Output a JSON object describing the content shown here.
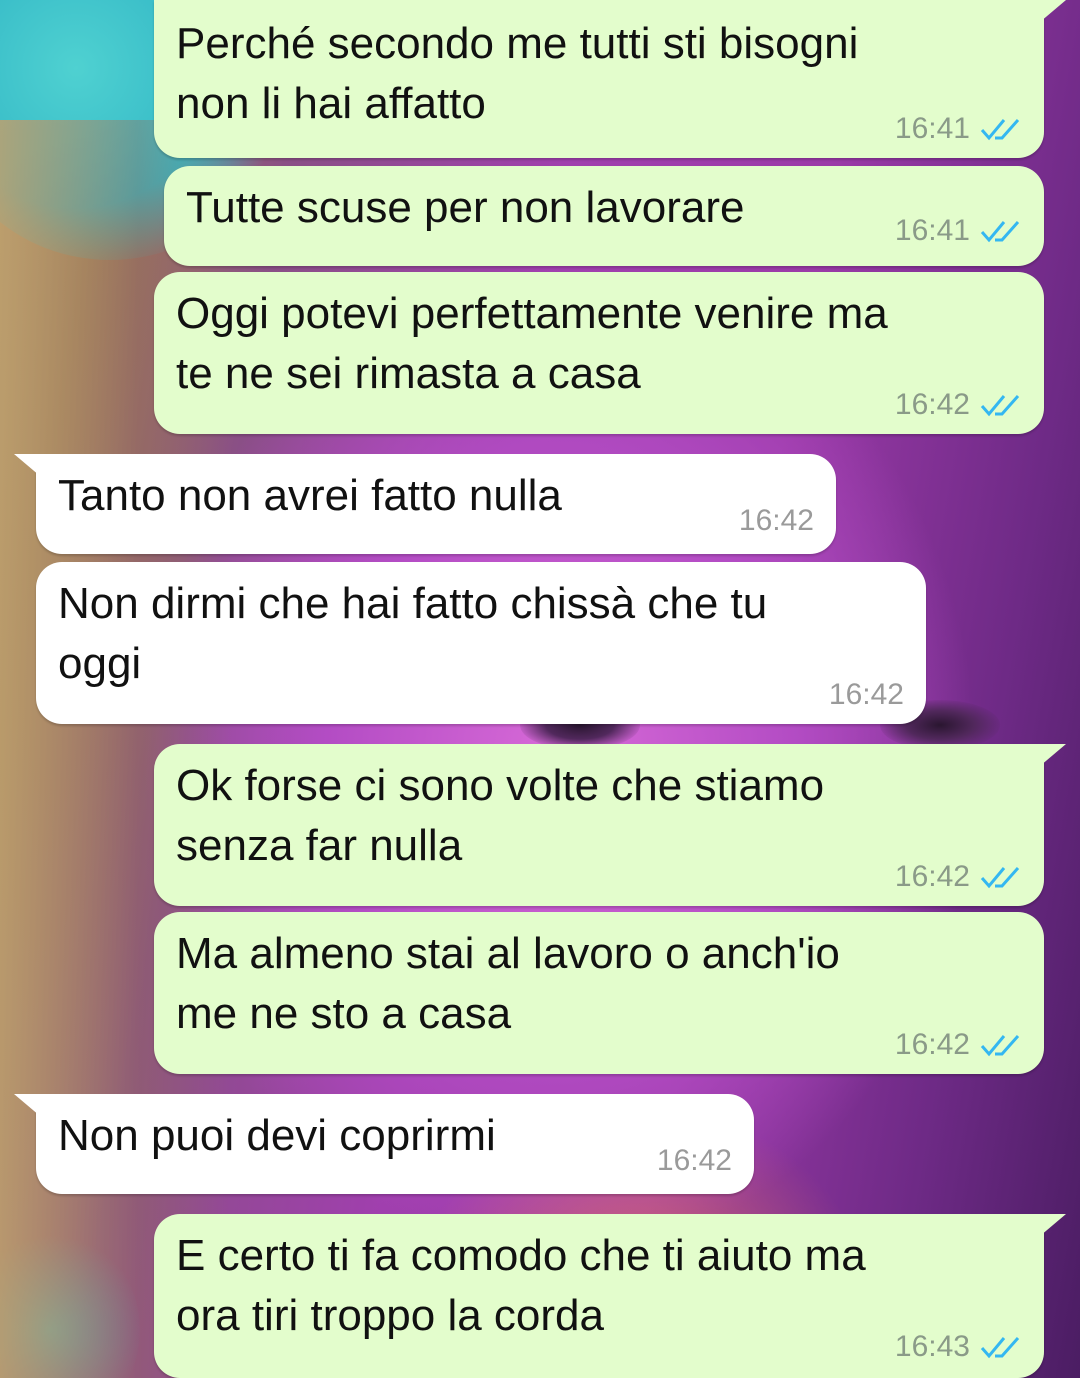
{
  "colors": {
    "outgoing_bubble": "#e3fdcc",
    "incoming_bubble": "#ffffff",
    "read_ticks": "#34b7f1",
    "timestamp": "#8a9a88"
  },
  "messages": [
    {
      "direction": "out",
      "text": "Perché secondo me tutti sti bisogni\nnon li hai affatto",
      "time": "16:41",
      "status_icon": "double-check-read-icon"
    },
    {
      "direction": "out",
      "text": "Tutte scuse per non lavorare",
      "time": "16:41",
      "status_icon": "double-check-read-icon"
    },
    {
      "direction": "out",
      "text": "Oggi potevi perfettamente venire ma\nte ne sei rimasta a casa",
      "time": "16:42",
      "status_icon": "double-check-read-icon"
    },
    {
      "direction": "in",
      "text": "Tanto non avrei fatto nulla",
      "time": "16:42"
    },
    {
      "direction": "in",
      "text": "Non dirmi che hai fatto chissà che tu\noggi",
      "time": "16:42"
    },
    {
      "direction": "out",
      "text": "Ok forse ci sono volte che stiamo\nsenza far nulla",
      "time": "16:42",
      "status_icon": "double-check-read-icon"
    },
    {
      "direction": "out",
      "text": "Ma almeno stai al lavoro o anch'io\nme ne sto a casa",
      "time": "16:42",
      "status_icon": "double-check-read-icon"
    },
    {
      "direction": "in",
      "text": "Non puoi devi coprirmi",
      "time": "16:42"
    },
    {
      "direction": "out",
      "text": "E certo ti fa comodo che ti aiuto ma\nora tiri troppo la corda",
      "time": "16:43",
      "status_icon": "double-check-read-icon"
    }
  ]
}
